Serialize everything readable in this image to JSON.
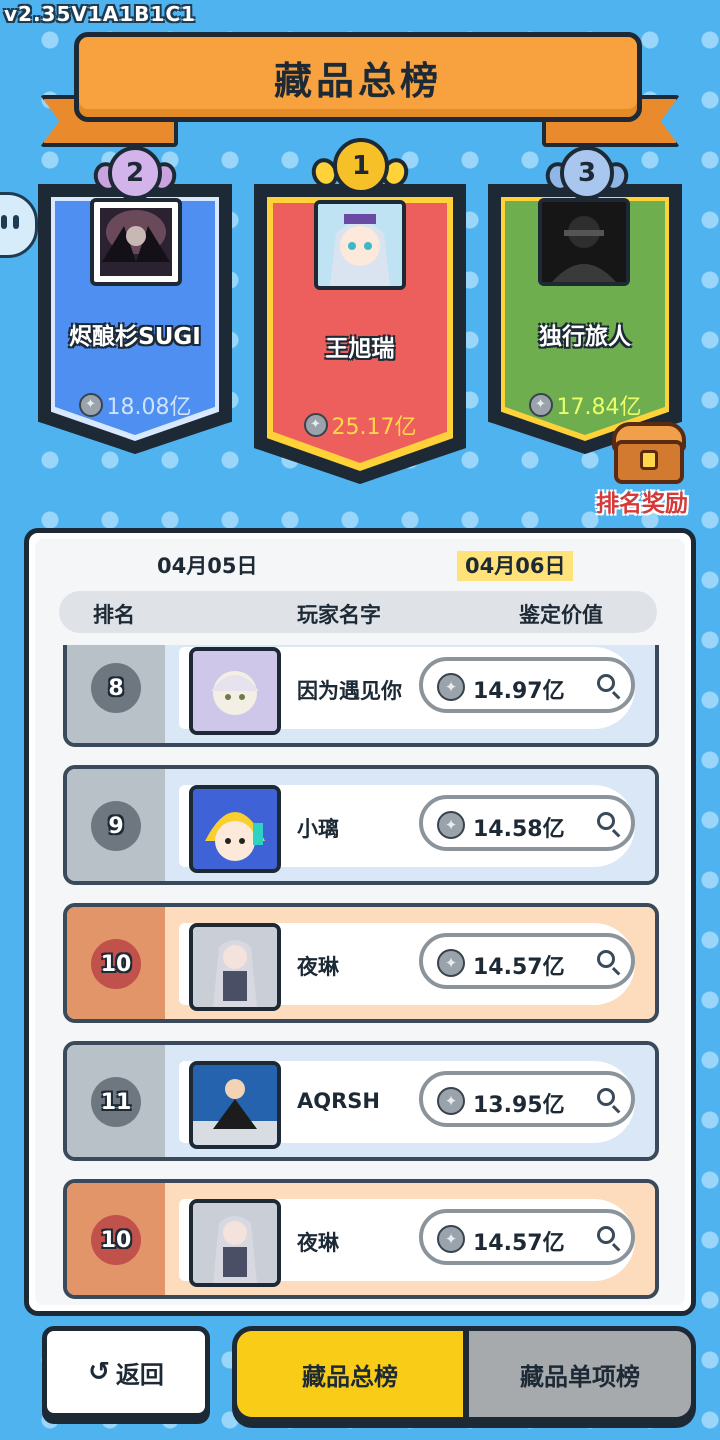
{
  "version": "v2.35V1A1B1C1",
  "title": "藏品总榜",
  "podium": [
    {
      "place": "2",
      "name": "烬酿杉SUGI",
      "value": "18.08亿",
      "color": "#4f8ff2",
      "value_color": "#cfe3ff"
    },
    {
      "place": "1",
      "name": "王旭瑞",
      "value": "25.17亿",
      "color": "#ec5f5c",
      "value_color": "#ffd84a"
    },
    {
      "place": "3",
      "name": "独行旅人",
      "value": "17.84亿",
      "color": "#6fae4f",
      "value_color": "#eaff6a"
    }
  ],
  "reward_label": "排名奖励",
  "dates": {
    "prev": "04月05日",
    "current": "04月06日"
  },
  "columns": {
    "rank": "排名",
    "player": "玩家名字",
    "value": "鉴定价值"
  },
  "rows": [
    {
      "rank": "8",
      "name": "因为遇见你",
      "value": "14.97亿",
      "style": "blue"
    },
    {
      "rank": "9",
      "name": "小璃",
      "value": "14.58亿",
      "style": "blue"
    },
    {
      "rank": "10",
      "name": "夜琳",
      "value": "14.57亿",
      "style": "orange"
    },
    {
      "rank": "11",
      "name": "AQRSH",
      "value": "13.95亿",
      "style": "blue"
    },
    {
      "rank": "10",
      "name": "夜琳",
      "value": "14.57亿",
      "style": "orange"
    }
  ],
  "buttons": {
    "back": "返回",
    "tab_total": "藏品总榜",
    "tab_single": "藏品单项榜"
  },
  "icons": {
    "coin": "coin-icon",
    "search": "magnifier-icon",
    "back": "back-arrow-icon",
    "chest": "treasure-chest-icon"
  }
}
